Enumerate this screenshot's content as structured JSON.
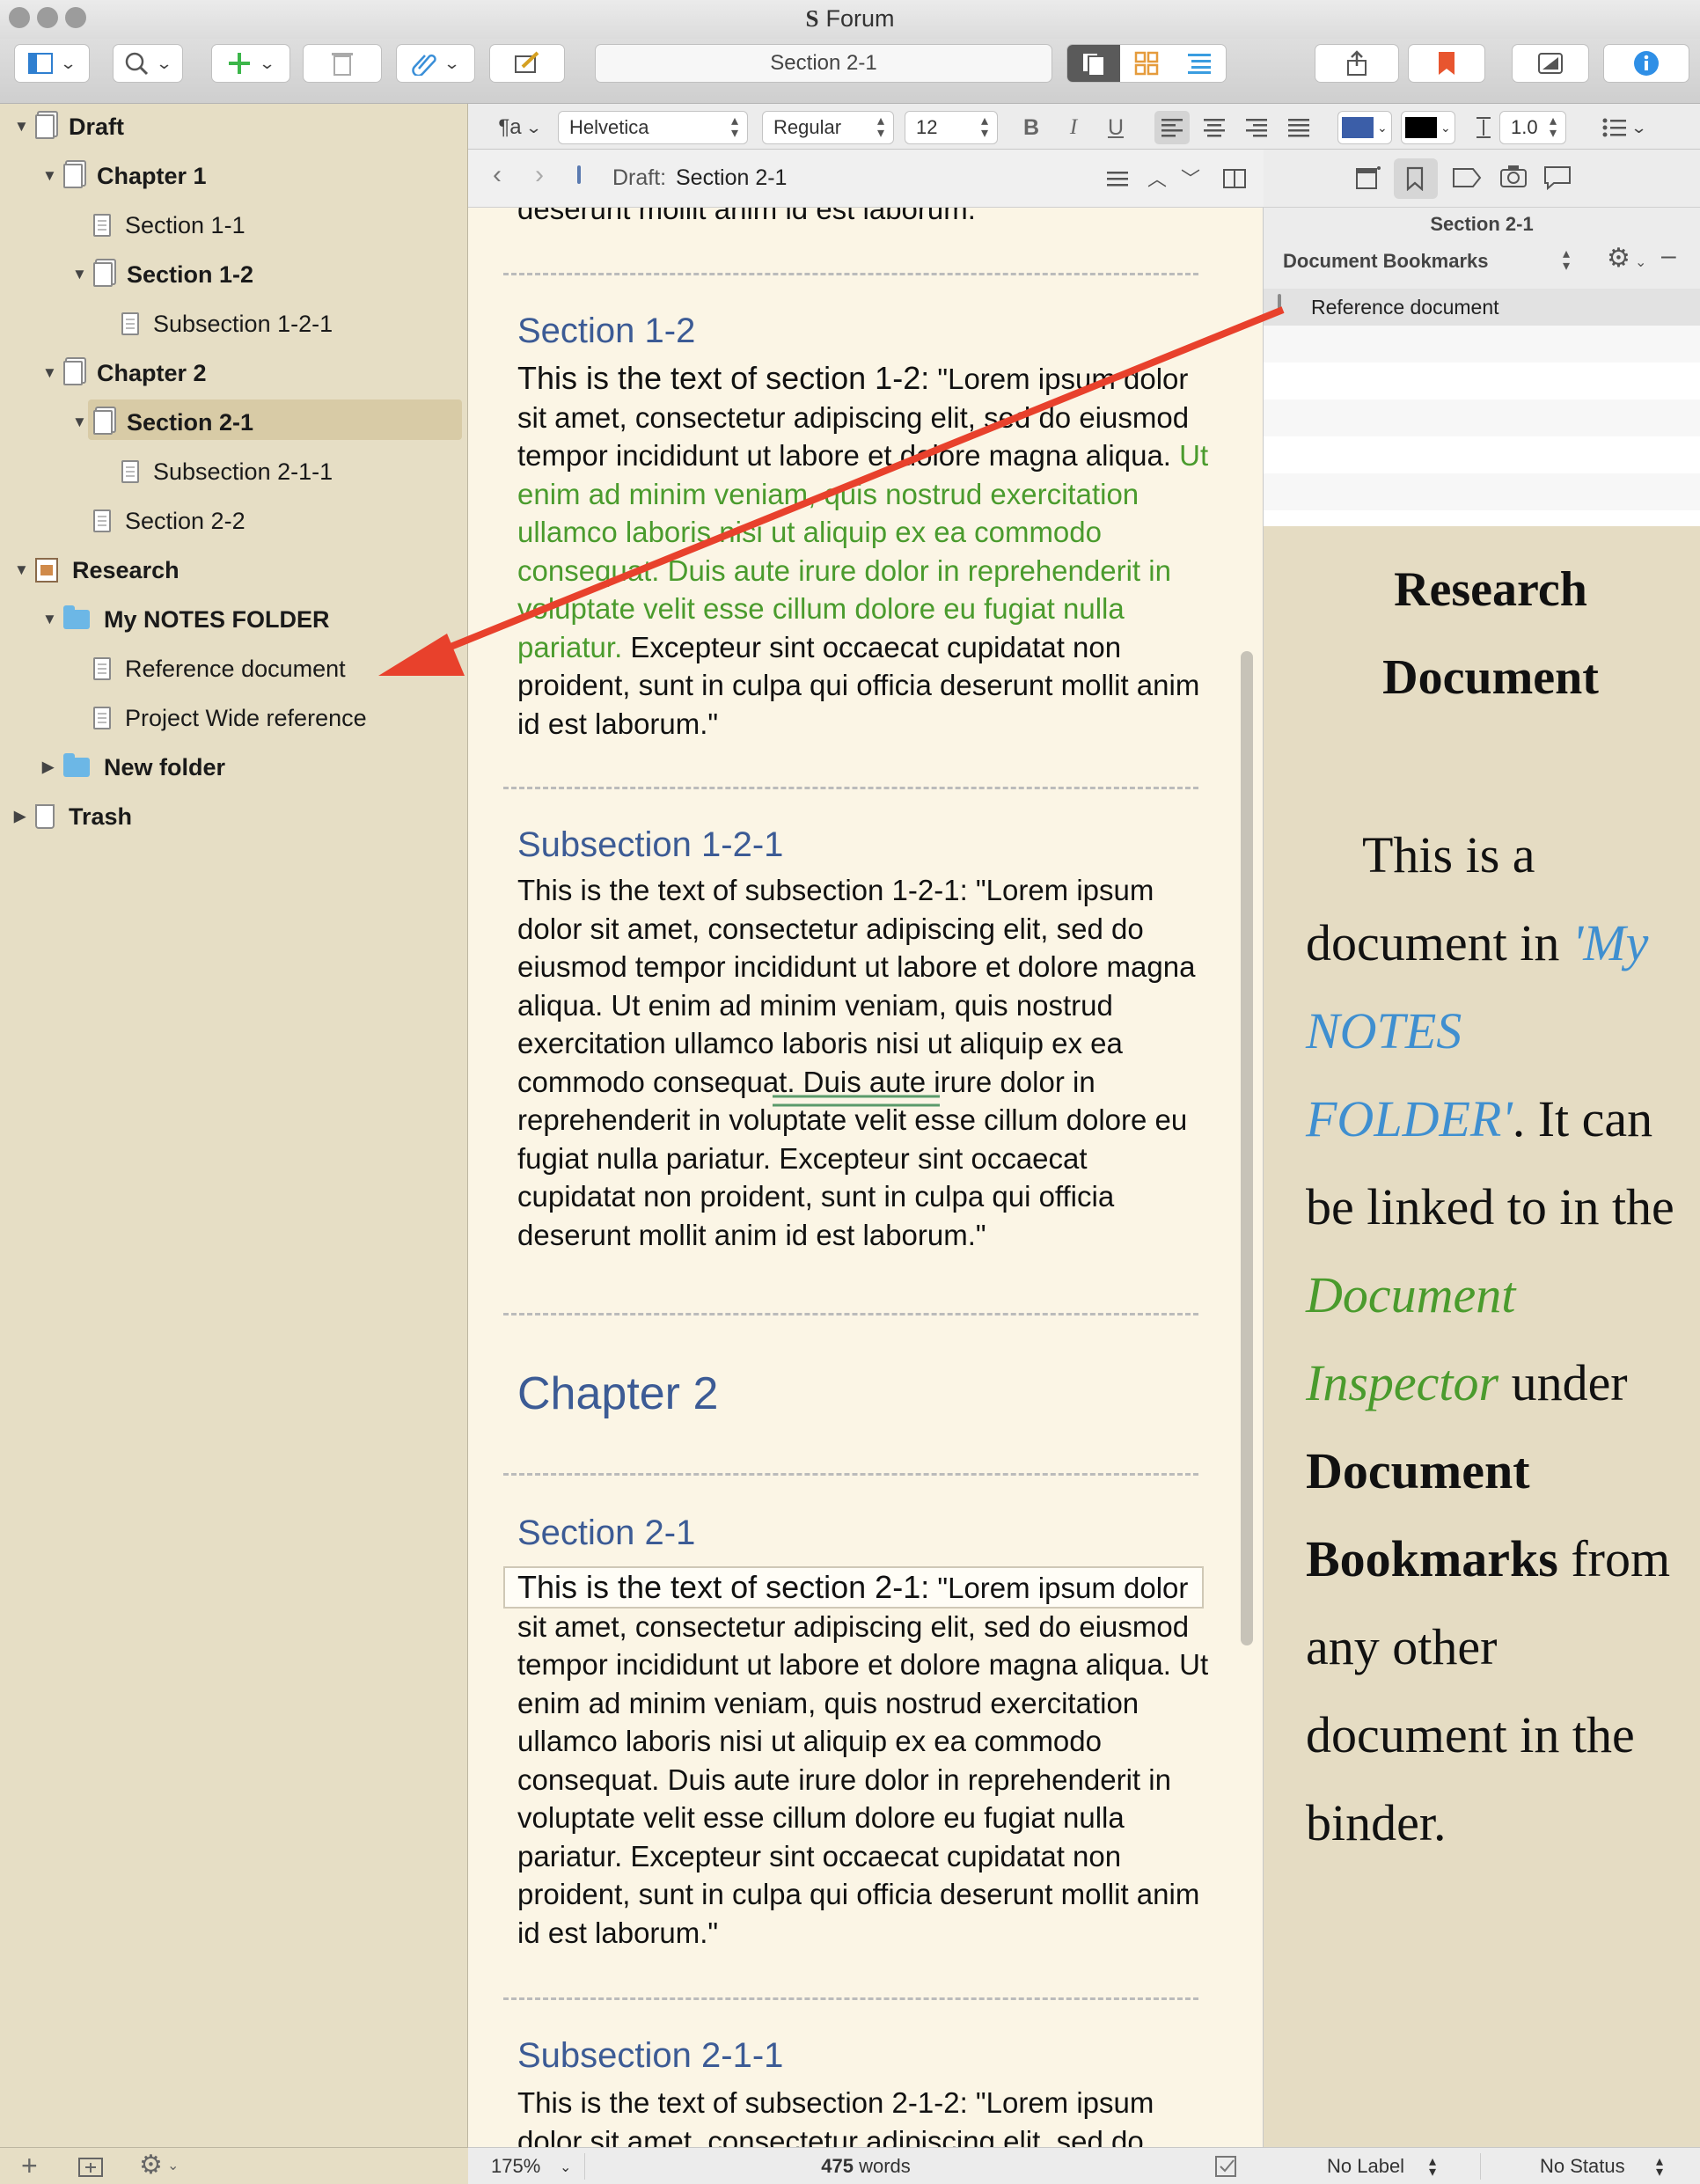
{
  "window": {
    "title": "Forum"
  },
  "toolbar": {
    "document_title": "Section 2-1"
  },
  "binder": {
    "items": [
      {
        "label": "Draft"
      },
      {
        "label": "Chapter 1"
      },
      {
        "label": "Section 1-1"
      },
      {
        "label": "Section 1-2"
      },
      {
        "label": "Subsection 1-2-1"
      },
      {
        "label": "Chapter 2"
      },
      {
        "label": "Section 2-1"
      },
      {
        "label": "Subsection 2-1-1"
      },
      {
        "label": "Section 2-2"
      },
      {
        "label": "Research"
      },
      {
        "label": "My NOTES FOLDER"
      },
      {
        "label": "Reference document"
      },
      {
        "label": "Project Wide reference"
      },
      {
        "label": "New folder"
      },
      {
        "label": "Trash"
      }
    ]
  },
  "format_bar": {
    "paragraph_style": "¶a",
    "font": "Helvetica",
    "weight": "Regular",
    "size": "12",
    "line_spacing": "1.0",
    "bold": "B",
    "italic": "I",
    "underline": "U"
  },
  "nav": {
    "path_prefix": "Draft:",
    "path_doc": "Section 2-1"
  },
  "editor": {
    "top_text": "deserunt mollit anim id est laborum.\"",
    "s12_title": "Section 1-2",
    "s12_lead": "This is the text of section 1-2:",
    "s12_text1": " \"Lorem ipsum dolor sit amet, consectetur adipiscing elit, sed do eiusmod tempor incididunt ut labore et dolore magna aliqua. ",
    "s12_green": "Ut enim ad minim veniam, quis nostrud exercitation ullamco laboris nisi ut aliquip ex ea commodo consequat. Duis aute irure dolor in reprehenderit in voluptate velit esse cillum dolore eu fugiat nulla pariatur.",
    "s12_text2": " Excepteur sint occaecat cupidatat non proident, sunt in culpa qui officia deserunt mollit anim id est laborum.\"",
    "ss121_title": "Subsection 1-2-1",
    "ss121_text": "This is the text of subsection 1-2-1: \"Lorem ipsum dolor sit amet, consectetur adipiscing elit, sed do eiusmod tempor incididunt ut labore et dolore magna aliqua. Ut enim ad minim veniam, quis nostrud exercitation ullamco laboris nisi ut aliquip ex ea commodo consequat. Duis aute irure dolor in reprehenderit in voluptate velit esse cillum dolore eu fugiat nulla pariatur. Excepteur sint occaecat cupidatat non proident, sunt in culpa qui officia deserunt mollit anim id est laborum.\"",
    "ch2_title": "Chapter 2",
    "s21_title": "Section 2-1",
    "s21_lead": "This is the text of section 2-1:",
    "s21_text": " \"Lorem ipsum dolor sit amet, consectetur adipiscing elit, sed do eiusmod tempor incididunt ut labore et dolore magna aliqua. Ut enim ad minim veniam, quis nostrud exercitation ullamco laboris nisi ut aliquip ex ea commodo consequat. Duis aute irure dolor in reprehenderit in voluptate velit esse cillum dolore eu fugiat nulla pariatur. Excepteur sint occaecat cupidatat non proident, sunt in culpa qui officia deserunt mollit anim id est laborum.\"",
    "ss211_title": "Subsection 2-1-1",
    "ss211_text": "This is the text of subsection 2-1-2: \"Lorem ipsum dolor sit amet, consectetur adipiscing elit, sed do"
  },
  "inspector": {
    "doc_title": "Section 2-1",
    "panel": "Document Bookmarks",
    "bookmarks": [
      {
        "label": "Reference document"
      }
    ],
    "preview": {
      "title": "Research Document",
      "p1": "This is a document in ",
      "p_blue": "'My NOTES FOLDER'",
      "p2": ". It can be linked to in the ",
      "p_green": "Document Inspector",
      "p3": " under ",
      "p_bold": "Document Bookmarks",
      "p4": " from any other document in the binder."
    }
  },
  "status": {
    "zoom": "175%",
    "word_count": "475",
    "word_label": "words",
    "label": "No Label",
    "status": "No Status"
  },
  "colors": {
    "accent_red": "#e8412c",
    "link_blue": "#3f8fd0",
    "green_text": "#4a9b2d",
    "heading_blue": "#3c5b95"
  }
}
